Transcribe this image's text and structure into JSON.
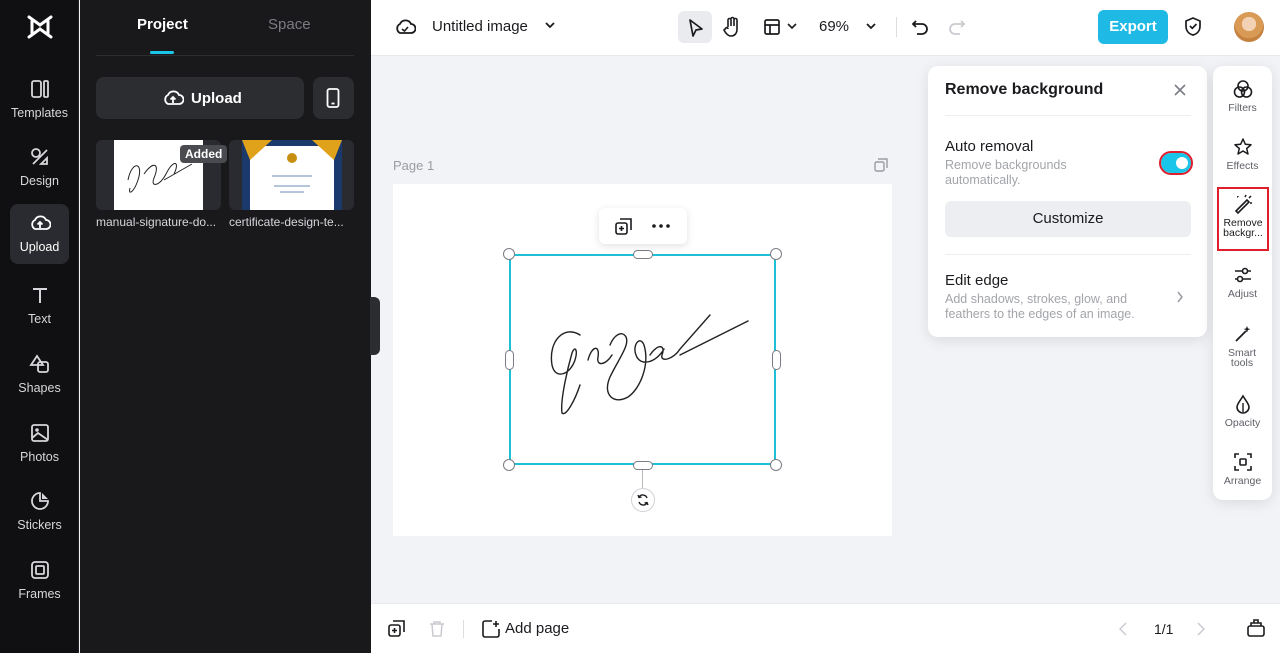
{
  "rail": {
    "items": [
      {
        "label": "Templates"
      },
      {
        "label": "Design"
      },
      {
        "label": "Upload"
      },
      {
        "label": "Text"
      },
      {
        "label": "Shapes"
      },
      {
        "label": "Photos"
      },
      {
        "label": "Stickers"
      },
      {
        "label": "Frames"
      }
    ],
    "active": "Upload"
  },
  "panel": {
    "tabs": [
      "Project",
      "Space"
    ],
    "active_tab": "Project",
    "upload_label": "Upload",
    "assets": [
      {
        "name": "manual-signature-do...",
        "badge": "Added"
      },
      {
        "name": "certificate-design-te..."
      }
    ]
  },
  "topbar": {
    "title": "Untitled image",
    "zoom": "69%",
    "export_label": "Export"
  },
  "canvas": {
    "page_label": "Page 1"
  },
  "popup": {
    "title": "Remove background",
    "auto_removal": {
      "title": "Auto removal",
      "desc": "Remove backgrounds automatically.",
      "enabled": true
    },
    "customize_label": "Customize",
    "edit_edge": {
      "title": "Edit edge",
      "desc": "Add shadows, strokes, glow, and feathers to the edges of an image."
    }
  },
  "right_tools": [
    {
      "label": "Filters"
    },
    {
      "label": "Effects"
    },
    {
      "label": "Remove backgr..."
    },
    {
      "label": "Adjust"
    },
    {
      "label": "Smart tools"
    },
    {
      "label": "Opacity"
    },
    {
      "label": "Arrange"
    }
  ],
  "bottombar": {
    "add_page_label": "Add page",
    "pager": "1/1"
  },
  "colors": {
    "accent": "#19c5e8",
    "highlight": "#e01f2c"
  }
}
